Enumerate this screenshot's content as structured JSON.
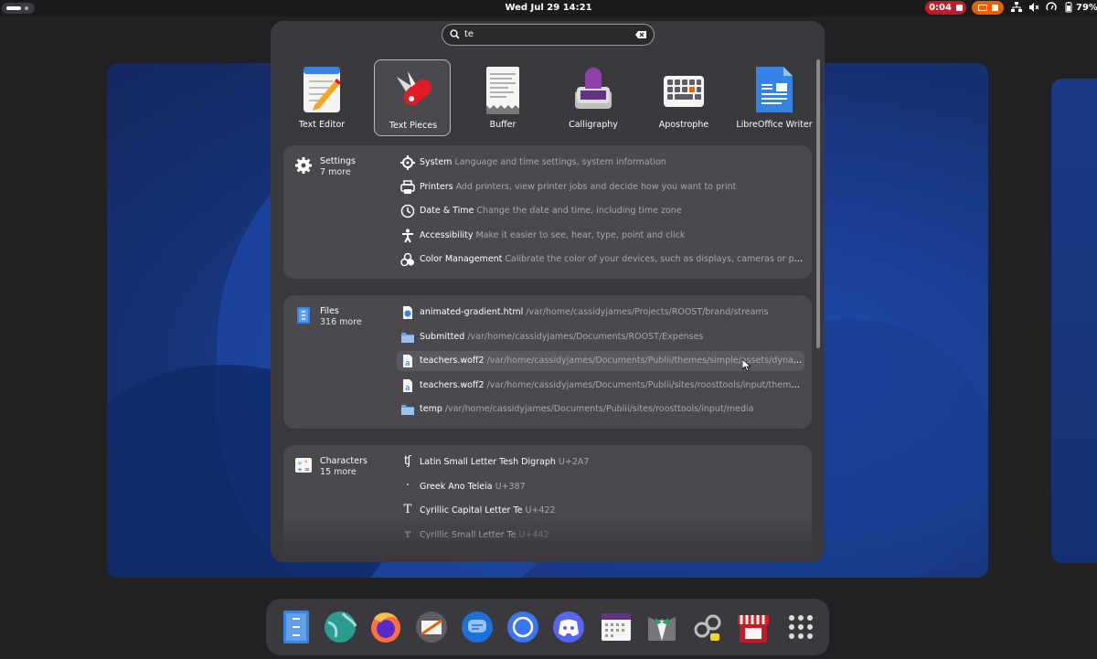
{
  "topbar": {
    "clock": "Wed Jul 29  14:21",
    "recording_time": "0:04",
    "battery": "79%"
  },
  "search": {
    "query": "te"
  },
  "apps": [
    {
      "label": "Text Editor",
      "icon": "text-editor-icon"
    },
    {
      "label": "Text Pieces",
      "icon": "text-pieces-icon",
      "selected": true
    },
    {
      "label": "Buffer",
      "icon": "buffer-icon"
    },
    {
      "label": "Calligraphy",
      "icon": "calligraphy-icon"
    },
    {
      "label": "Apostrophe",
      "icon": "apostrophe-icon"
    },
    {
      "label": "LibreOffice Writer",
      "icon": "libreoffice-writer-icon"
    }
  ],
  "settings": {
    "name": "Settings",
    "more": "7 more",
    "results": [
      {
        "title": "System",
        "desc": "Language and time settings, system information",
        "icon": "gear-icon"
      },
      {
        "title": "Printers",
        "desc": "Add printers, view printer jobs and decide how you want to print",
        "icon": "printer-icon"
      },
      {
        "title": "Date & Time",
        "desc": "Change the date and time, including time zone",
        "icon": "clock-icon"
      },
      {
        "title": "Accessibility",
        "desc": "Make it easier to see, hear, type, point and click",
        "icon": "accessibility-icon"
      },
      {
        "title": "Color Management",
        "desc": "Calibrate the color of your devices, such as displays, cameras or printers",
        "icon": "color-icon"
      }
    ]
  },
  "files": {
    "name": "Files",
    "more": "316 more",
    "results": [
      {
        "title": "animated-gradient.html",
        "desc": "/var/home/cassidyjames/Projects/ROOST/brand/streams",
        "icon": "html-file-icon"
      },
      {
        "title": "Submitted",
        "desc": "/var/home/cassidyjames/Documents/ROOST/Expenses",
        "icon": "folder-icon"
      },
      {
        "title": "teachers.woff2",
        "desc": "/var/home/cassidyjames/Documents/Publii/themes/simple/assets/dynamic/fonts/...",
        "icon": "font-file-icon"
      },
      {
        "title": "teachers.woff2",
        "desc": "/var/home/cassidyjames/Documents/Publii/sites/roosttools/input/themes/simple/...",
        "icon": "font-file-icon"
      },
      {
        "title": "temp",
        "desc": "/var/home/cassidyjames/Documents/Publii/sites/roosttools/input/media",
        "icon": "folder-icon"
      }
    ]
  },
  "characters": {
    "name": "Characters",
    "more": "15 more",
    "results": [
      {
        "glyph": "ʧ",
        "title": "Latin Small Letter Tesh Digraph",
        "desc": "U+2A7"
      },
      {
        "glyph": "·",
        "title": "Greek Ano Teleia",
        "desc": "U+387"
      },
      {
        "glyph": "Т",
        "title": "Cyrillic Capital Letter Te",
        "desc": "U+422"
      },
      {
        "glyph": "т",
        "title": "Cyrillic Small Letter Te",
        "desc": "U+442"
      }
    ]
  },
  "dock": [
    "files-icon",
    "globe-icon",
    "firefox-icon",
    "mail-icon",
    "chat-icon",
    "signal-icon",
    "discord-icon",
    "calendar-icon",
    "tuxedo-icon",
    "handles-icon",
    "store-icon",
    "app-grid-icon"
  ]
}
